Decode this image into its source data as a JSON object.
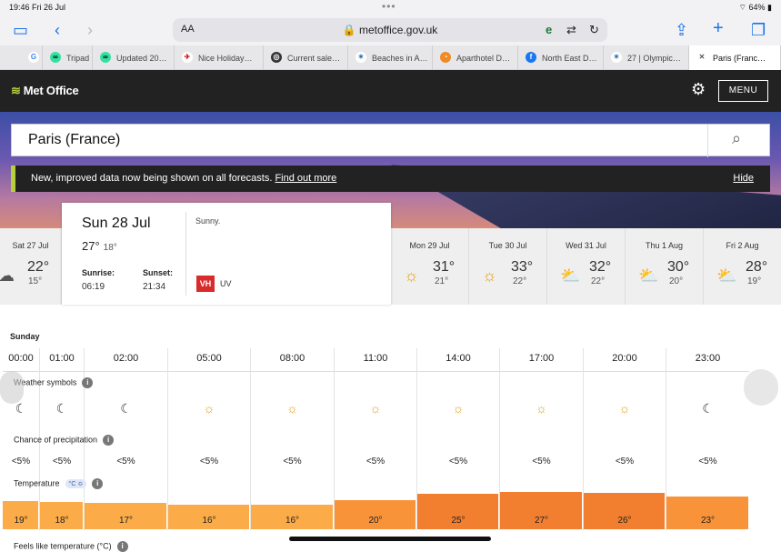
{
  "status": {
    "time_date": "19:46  Fri 26 Jul",
    "battery": "64%"
  },
  "browser": {
    "aa_label": "AA",
    "url": "metoffice.gov.uk",
    "tabs": [
      {
        "label": "",
        "icon": "google-icon"
      },
      {
        "label": "Tripad",
        "icon": "tripadvisor-icon"
      },
      {
        "label": "Updated 20…",
        "icon": "tripadvisor-icon"
      },
      {
        "label": "Nice Holiday…",
        "icon": "site-icon"
      },
      {
        "label": "Current sale…",
        "icon": "site-icon"
      },
      {
        "label": "Beaches in A…",
        "icon": "site-icon"
      },
      {
        "label": "Aparthotel D…",
        "icon": "booking-icon"
      },
      {
        "label": "North East D…",
        "icon": "facebook-icon"
      },
      {
        "label": "27 | Olympic…",
        "icon": "site-icon"
      },
      {
        "label": "Paris (Franc…",
        "icon": "close-icon"
      }
    ]
  },
  "header": {
    "logo": "Met Office",
    "menu_label": "MENU"
  },
  "search": {
    "value": "Paris (France)"
  },
  "banner": {
    "text": "New, improved data now being shown on all forecasts.",
    "link": "Find out more",
    "hide": "Hide"
  },
  "days": [
    {
      "name": "Sat 27 Jul",
      "hi": "22°",
      "lo": "15°",
      "icon": "rain-icon"
    },
    {
      "name": "Mon 29 Jul",
      "hi": "31°",
      "lo": "21°",
      "icon": "sun-icon"
    },
    {
      "name": "Tue 30 Jul",
      "hi": "33°",
      "lo": "22°",
      "icon": "sun-icon"
    },
    {
      "name": "Wed 31 Jul",
      "hi": "32°",
      "lo": "22°",
      "icon": "sun-cloud-icon"
    },
    {
      "name": "Thu 1 Aug",
      "hi": "30°",
      "lo": "20°",
      "icon": "sun-cloud-icon"
    },
    {
      "name": "Fri 2 Aug",
      "hi": "28°",
      "lo": "19°",
      "icon": "sun-cloud-icon"
    }
  ],
  "selected_day": {
    "date": "Sun 28 Jul",
    "hi": "27°",
    "lo": "18°",
    "sunrise_label": "Sunrise:",
    "sunrise": "06:19",
    "sunset_label": "Sunset:",
    "sunset": "21:34",
    "summary": "Sunny.",
    "uv_code": "VH",
    "uv_label": "UV"
  },
  "hourly": {
    "day_label": "Sunday",
    "symbols_label": "Weather symbols",
    "precip_label": "Chance of precipitation",
    "temp_label": "Temperature",
    "temp_unit": "°C ≎",
    "feels_label": "Feels like temperature (°C)",
    "hours": [
      "00:00",
      "01:00",
      "02:00",
      "05:00",
      "08:00",
      "11:00",
      "14:00",
      "17:00",
      "20:00",
      "23:00"
    ],
    "symbols": [
      "moon",
      "moon",
      "moon",
      "sun",
      "sun",
      "sun",
      "sun",
      "sun",
      "sun",
      "moon"
    ],
    "precip": [
      "<5%",
      "<5%",
      "<5%",
      "<5%",
      "<5%",
      "<5%",
      "<5%",
      "<5%",
      "<5%",
      "<5%"
    ],
    "temps": [
      "19°",
      "18°",
      "17°",
      "16°",
      "16°",
      "20°",
      "25°",
      "27°",
      "26°",
      "23°"
    ],
    "temp_values": [
      19,
      18,
      17,
      16,
      16,
      20,
      25,
      27,
      26,
      23
    ]
  }
}
